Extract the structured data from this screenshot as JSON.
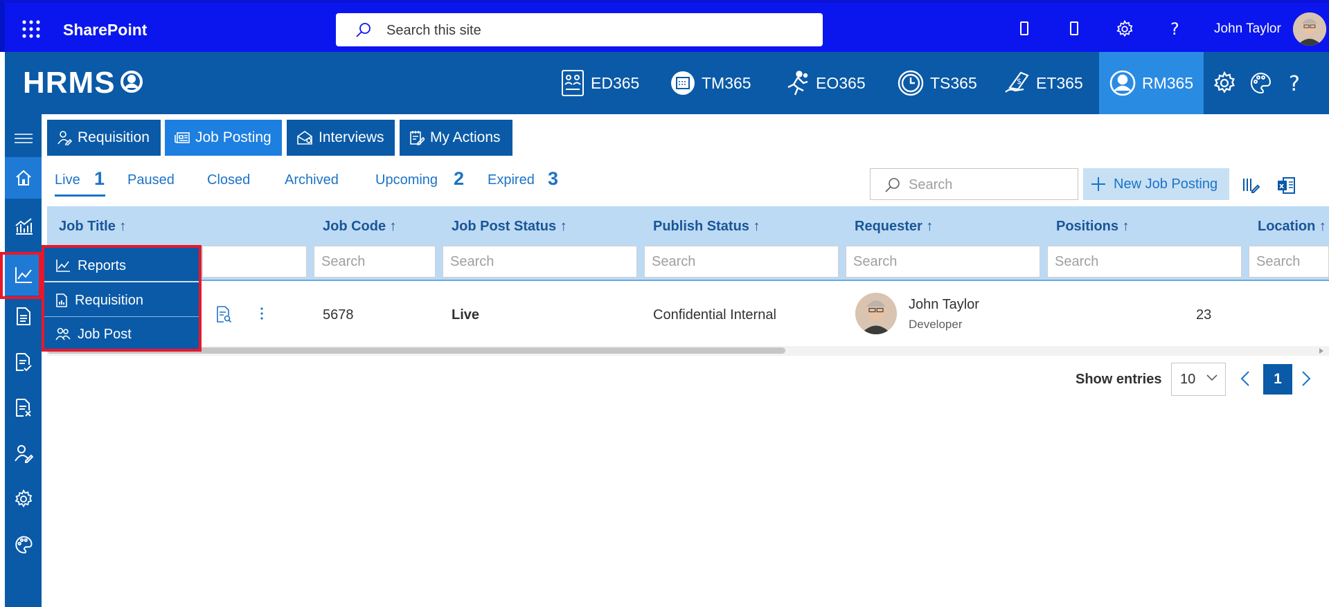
{
  "suite_bar": {
    "app_name": "SharePoint",
    "search_placeholder": "Search this site",
    "user_name": "John Taylor"
  },
  "hrms": {
    "logo": "HRMS",
    "modules": [
      {
        "label": "ED365",
        "icon": "employee-directory-icon"
      },
      {
        "label": "TM365",
        "icon": "task-manager-icon"
      },
      {
        "label": "EO365",
        "icon": "onboarding-icon"
      },
      {
        "label": "TS365",
        "icon": "timesheet-icon"
      },
      {
        "label": "ET365",
        "icon": "expense-icon"
      },
      {
        "label": "RM365",
        "icon": "recruitment-icon",
        "active": true
      }
    ]
  },
  "tabs": [
    {
      "label": "Requisition",
      "icon": "person-edit-icon"
    },
    {
      "label": "Job Posting",
      "icon": "news-icon",
      "active": true
    },
    {
      "label": "Interviews",
      "icon": "mail-person-icon"
    },
    {
      "label": "My Actions",
      "icon": "notepad-edit-icon"
    }
  ],
  "status_filters": {
    "live": "Live",
    "live_count": "1",
    "paused": "Paused",
    "closed": "Closed",
    "archived": "Archived",
    "upcoming": "Upcoming",
    "upcoming_count": "2",
    "expired": "Expired",
    "expired_count": "3"
  },
  "toolbar": {
    "search_placeholder": "Search",
    "new_button": "New Job Posting"
  },
  "grid": {
    "columns": [
      "Job Title ↑",
      "Job Code ↑",
      "Job Post Status ↑",
      "Publish Status ↑",
      "Requester ↑",
      "Positions ↑",
      "Location ↑"
    ],
    "filter_placeholder": "Search",
    "row": {
      "job_code": "5678",
      "job_post_status": "Live",
      "publish_status": "Confidential Internal",
      "requester_name": "John Taylor",
      "requester_role": "Developer",
      "positions": "23"
    }
  },
  "pagination": {
    "show_entries_label": "Show entries",
    "page_size": "10",
    "current_page": "1"
  },
  "reports_menu": {
    "items": [
      {
        "label": "Reports",
        "icon": "line-chart-icon"
      },
      {
        "label": "Requisition",
        "icon": "report-doc-icon"
      },
      {
        "label": "Job Post",
        "icon": "people-icon"
      }
    ]
  },
  "colors": {
    "suite_bar": "#0b16ee",
    "brand": "#0a5aa7",
    "accent": "#1d7fe0",
    "highlight": "#e8182b"
  }
}
